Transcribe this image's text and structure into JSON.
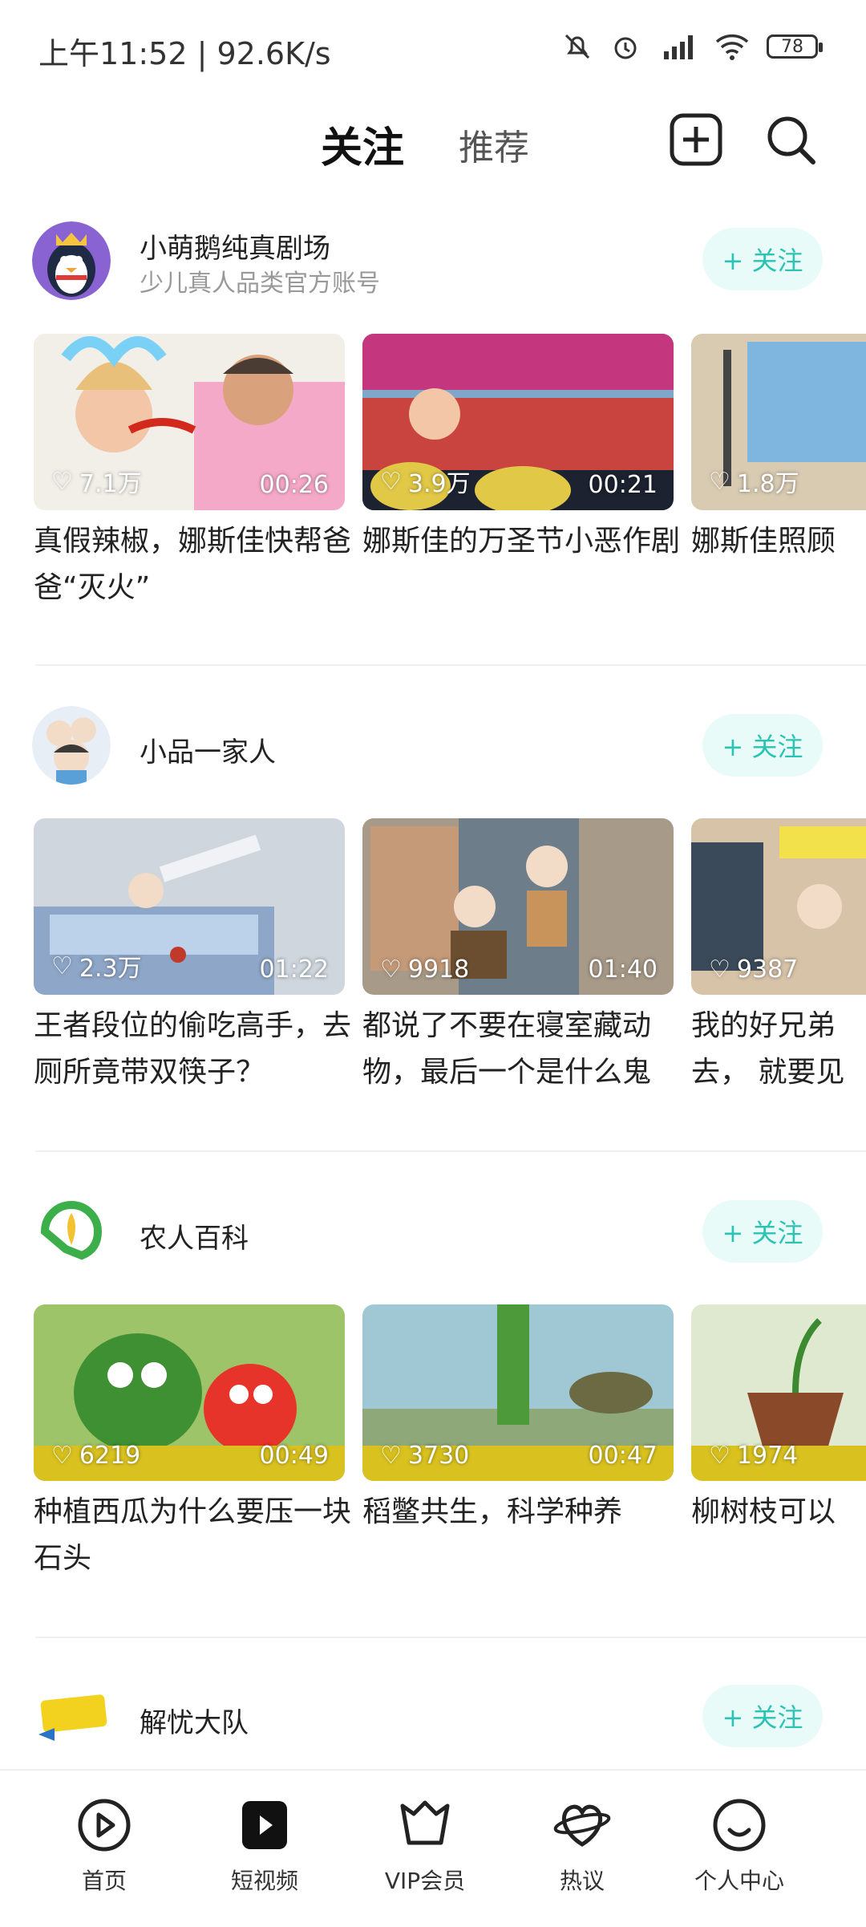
{
  "status_bar": {
    "time_text": "上午11:52 | 92.6K/s",
    "battery": "78"
  },
  "header": {
    "tab_following": "关注",
    "tab_recommend": "推荐"
  },
  "follow_label": "+ 关注",
  "accounts": [
    {
      "name": "小萌鹅纯真剧场",
      "subtitle": "少儿真人品类官方账号",
      "videos": [
        {
          "likes": "7.1万",
          "duration": "00:26",
          "title": "真假辣椒，娜斯佳快帮爸爸“灭火”"
        },
        {
          "likes": "3.9万",
          "duration": "00:21",
          "title": "娜斯佳的万圣节小恶作剧"
        },
        {
          "likes": "1.8万",
          "duration": "",
          "title": "娜斯佳照顾"
        }
      ]
    },
    {
      "name": "小品一家人",
      "subtitle": "",
      "videos": [
        {
          "likes": "2.3万",
          "duration": "01:22",
          "title": "王者段位的偷吃高手，去厕所竟带双筷子？"
        },
        {
          "likes": "9918",
          "duration": "01:40",
          "title": "都说了不要在寝室藏动物，最后一个是什么鬼"
        },
        {
          "likes": "9387",
          "duration": "",
          "title": "我的好兄弟去， 就要见"
        }
      ]
    },
    {
      "name": "农人百科",
      "subtitle": "",
      "videos": [
        {
          "likes": "6219",
          "duration": "00:49",
          "title": "种植西瓜为什么要压一块石头"
        },
        {
          "likes": "3730",
          "duration": "00:47",
          "title": "稻鳖共生，科学种养"
        },
        {
          "likes": "1974",
          "duration": "",
          "title": "柳树枝可以"
        }
      ]
    },
    {
      "name": "解忧大队",
      "subtitle": "",
      "videos": []
    }
  ],
  "bottom_nav": [
    {
      "label": "首页",
      "icon": "play-circle-icon"
    },
    {
      "label": "短视频",
      "icon": "short-video-icon"
    },
    {
      "label": "VIP会员",
      "icon": "vip-crown-icon"
    },
    {
      "label": "热议",
      "icon": "hot-discussion-icon"
    },
    {
      "label": "个人中心",
      "icon": "profile-smile-icon"
    }
  ],
  "colors": {
    "accent": "#2bc3b3",
    "follow_bg": "#e9fbf8"
  }
}
